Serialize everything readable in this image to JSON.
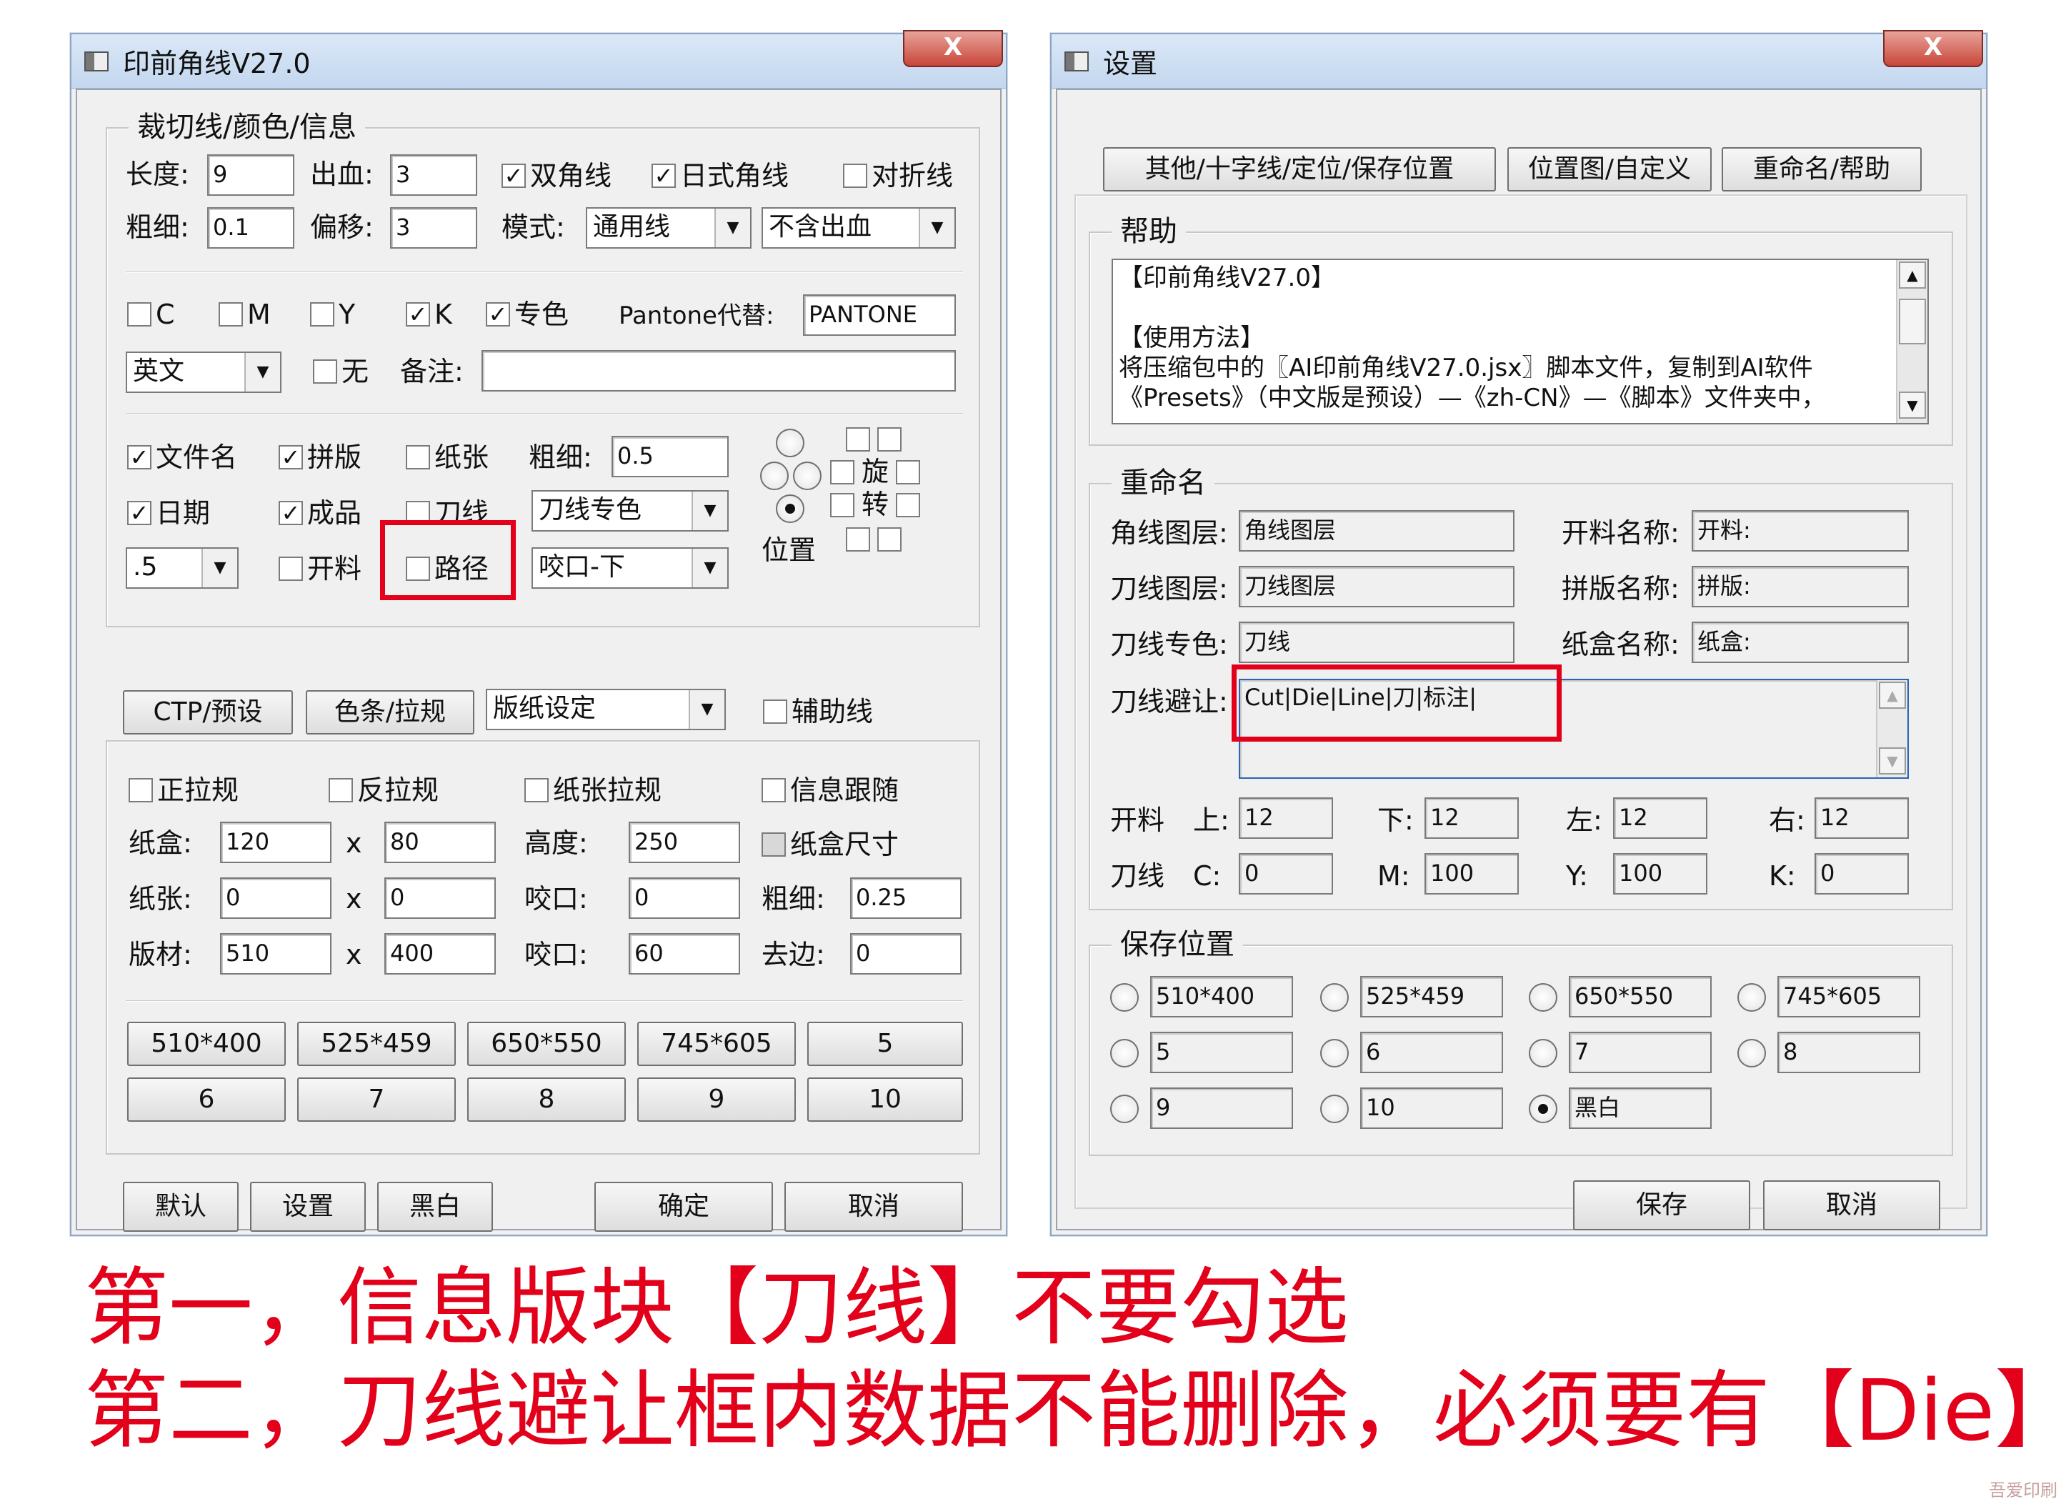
{
  "left_window": {
    "title": "印前角线V27.0",
    "close_glyph": "X",
    "group1": {
      "title": "裁切线/颜色/信息",
      "length_label": "长度:",
      "length_value": "9",
      "bleed_label": "出血:",
      "bleed_value": "3",
      "double_corner": "双角线",
      "japan_corner": "日式角线",
      "fold_line": "对折线",
      "thickness_label": "粗细:",
      "thickness_value": "0.1",
      "offset_label": "偏移:",
      "offset_value": "3",
      "mode_label": "模式:",
      "mode_value": "通用线",
      "bleed_mode_value": "不含出血",
      "c": "C",
      "m": "M",
      "y": "Y",
      "k": "K",
      "spot": "专色",
      "pantone_label": "Pantone代替:",
      "pantone_value": "PANTONE",
      "lang_value": "英文",
      "none_label": "无",
      "note_label": "备注:",
      "note_value": "",
      "filename": "文件名",
      "imposition": "拼版",
      "paper": "纸张",
      "info_thick_label": "粗细:",
      "info_thick_value": "0.5",
      "date": "日期",
      "product": "成品",
      "dieline": "刀线",
      "dieline_spot_value": "刀线专色",
      "size_value": ".5",
      "cutting": "开料",
      "path": "路径",
      "gripper_value": "咬口-下",
      "position_label": "位置",
      "rotate_1": "旋",
      "rotate_2": "转"
    },
    "tabs": {
      "ctp": "CTP/预设",
      "colorbar": "色条/拉规",
      "sheet_value": "版纸设定",
      "guide": "辅助线"
    },
    "group2": {
      "front_pull": "正拉规",
      "back_pull": "反拉规",
      "paper_pull": "纸张拉规",
      "info_follow": "信息跟随",
      "box_label": "纸盒:",
      "box_w": "120",
      "x1": "x",
      "box_h": "80",
      "height_label": "高度:",
      "height_value": "250",
      "box_size": "纸盒尺寸",
      "paper_label": "纸张:",
      "paper_w": "0",
      "x2": "x",
      "paper_h": "0",
      "grip1_label": "咬口:",
      "grip1_value": "0",
      "thick_label": "粗细:",
      "thick_value": "0.25",
      "plate_label": "版材:",
      "plate_w": "510",
      "x3": "x",
      "plate_h": "400",
      "grip2_label": "咬口:",
      "grip2_value": "60",
      "trim_label": "去边:",
      "trim_value": "0",
      "presets": [
        "510*400",
        "525*459",
        "650*550",
        "745*605",
        "5",
        "6",
        "7",
        "8",
        "9",
        "10"
      ]
    },
    "buttons": {
      "default": "默认",
      "settings": "设置",
      "bw": "黑白",
      "ok": "确定",
      "cancel": "取消"
    }
  },
  "right_window": {
    "title": "设置",
    "close_glyph": "X",
    "tabs": [
      "其他/十字线/定位/保存位置",
      "位置图/自定义",
      "重命名/帮助"
    ],
    "help": {
      "title": "帮助",
      "text": "【印前角线V27.0】\n\n【使用方法】\n将压缩包中的〖AI印前角线V27.0.jsx〗脚本文件，复制到AI软件\n《Presets》（中文版是预设）—《zh-CN》—《脚本》文件夹中，"
    },
    "rename": {
      "title": "重命名",
      "corner_layer_label": "角线图层:",
      "corner_layer_value": "角线图层",
      "cut_name_label": "开料名称:",
      "cut_name_value": "开料:",
      "die_layer_label": "刀线图层:",
      "die_layer_value": "刀线图层",
      "imp_name_label": "拼版名称:",
      "imp_name_value": "拼版:",
      "die_spot_label": "刀线专色:",
      "die_spot_value": "刀线",
      "box_name_label": "纸盒名称:",
      "box_name_value": "纸盒:",
      "die_avoid_label": "刀线避让:",
      "die_avoid_value": "Cut|Die|Line|刀|标注|",
      "cut_label": "开料",
      "top": "上:",
      "top_v": "12",
      "bottom": "下:",
      "bottom_v": "12",
      "left": "左:",
      "left_v": "12",
      "right": "右:",
      "right_v": "12",
      "die_label": "刀线",
      "c": "C:",
      "c_v": "0",
      "m": "M:",
      "m_v": "100",
      "y": "Y:",
      "y_v": "100",
      "k": "K:",
      "k_v": "0"
    },
    "save": {
      "title": "保存位置",
      "slots": [
        "510*400",
        "525*459",
        "650*550",
        "745*605",
        "5",
        "6",
        "7",
        "8",
        "9",
        "10",
        "黑白"
      ]
    },
    "buttons": {
      "save": "保存",
      "cancel": "取消"
    }
  },
  "captions": {
    "line1": "第一，信息版块【刀线】不要勾选",
    "line2": "第二，刀线避让框内数据不能删除，必须要有【Die】"
  },
  "watermark": "吾爱印刷",
  "colors": {
    "accent_red": "#e2001a"
  }
}
